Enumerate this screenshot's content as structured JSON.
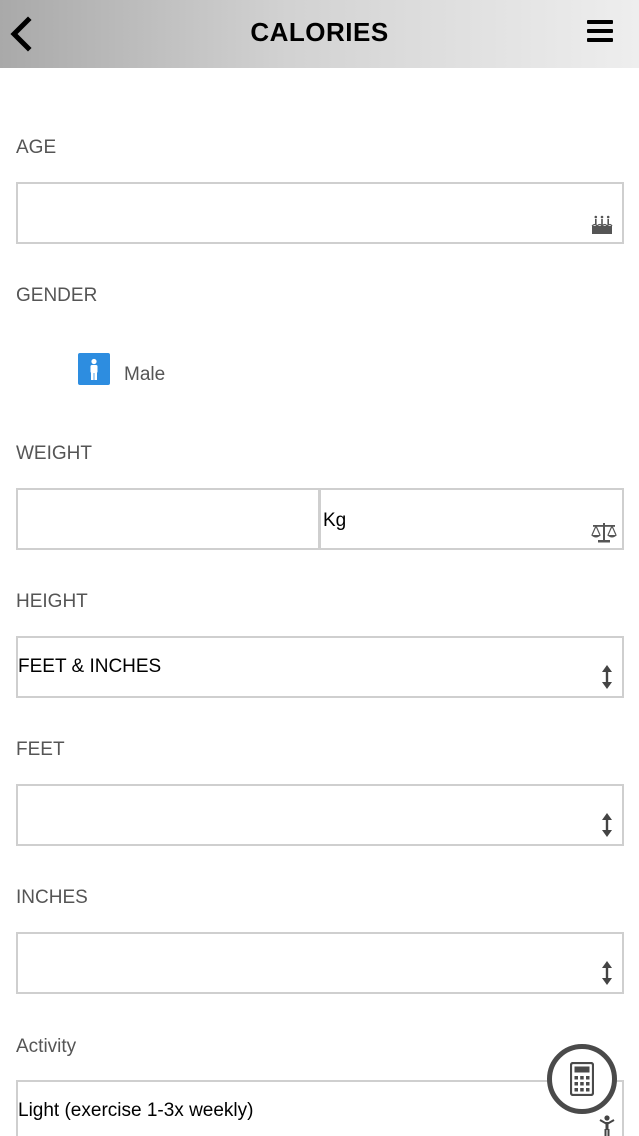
{
  "header": {
    "title": "CALORIES",
    "back_icon": "chevron-left-icon",
    "menu_icon": "hamburger-menu-icon",
    "background_gradient": [
      "#a9a9a9",
      "#eeeeee"
    ]
  },
  "form": {
    "age": {
      "label": "AGE",
      "value": "",
      "icon": "birthday-cake-icon"
    },
    "gender": {
      "label": "GENDER",
      "option": "Male",
      "icon": "male-person-icon",
      "accent": "#2d8de0"
    },
    "weight": {
      "label": "WEIGHT",
      "value": "",
      "unit": "Kg",
      "icon": "scale-icon"
    },
    "height": {
      "label": "HEIGHT",
      "value": "FEET & INCHES",
      "icon": "up-down-arrows-icon"
    },
    "feet": {
      "label": "FEET",
      "value": "",
      "icon": "up-down-arrows-icon"
    },
    "inches": {
      "label": "INCHES",
      "value": "",
      "icon": "up-down-arrows-icon"
    },
    "activity": {
      "label": "Activity",
      "value": "Light (exercise 1-3x weekly)",
      "icon": "person-activity-icon"
    }
  },
  "calculate_button": {
    "icon": "calculator-icon"
  }
}
